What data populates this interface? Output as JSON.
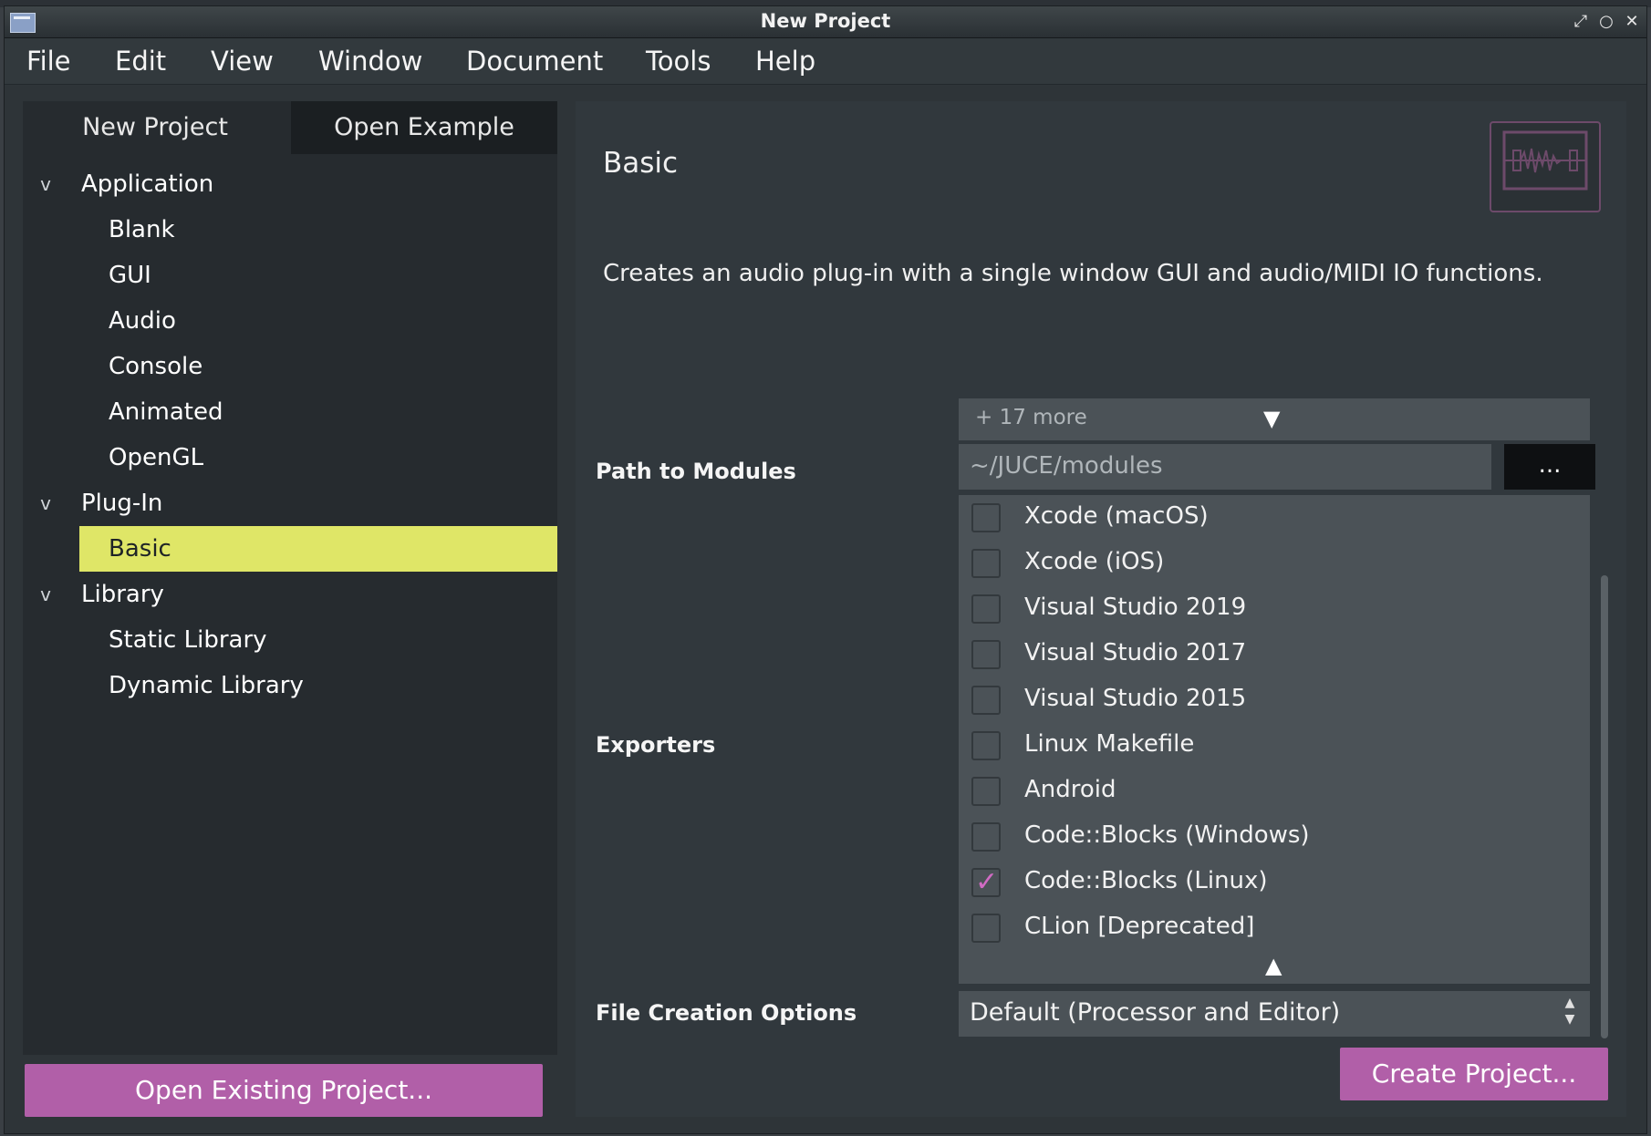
{
  "window": {
    "title": "New Project"
  },
  "menu": [
    "File",
    "Edit",
    "View",
    "Window",
    "Document",
    "Tools",
    "Help"
  ],
  "left_panel": {
    "tabs": [
      "New Project",
      "Open Example"
    ],
    "tree": {
      "application": {
        "label": "Application",
        "items": [
          "Blank",
          "GUI",
          "Audio",
          "Console",
          "Animated",
          "OpenGL"
        ]
      },
      "plugin": {
        "label": "Plug-In",
        "items": [
          "Basic"
        ]
      },
      "library": {
        "label": "Library",
        "items": [
          "Static Library",
          "Dynamic Library"
        ]
      }
    },
    "selected_item": "Basic",
    "open_existing_label": "Open Existing Project..."
  },
  "right_panel": {
    "heading": "Basic",
    "description": "Creates an audio plug-in with a single window GUI and audio/MIDI IO functions.",
    "path_to_modules": {
      "label": "Path to Modules",
      "more_text": "+ 17 more",
      "value": "~/JUCE/modules",
      "browse_label": "..."
    },
    "exporters": {
      "label": "Exporters",
      "items": [
        {
          "label": "Xcode (macOS)",
          "checked": false
        },
        {
          "label": "Xcode (iOS)",
          "checked": false
        },
        {
          "label": "Visual Studio 2019",
          "checked": false
        },
        {
          "label": "Visual Studio 2017",
          "checked": false
        },
        {
          "label": "Visual Studio 2015",
          "checked": false
        },
        {
          "label": "Linux Makefile",
          "checked": false
        },
        {
          "label": "Android",
          "checked": false
        },
        {
          "label": "Code::Blocks (Windows)",
          "checked": false
        },
        {
          "label": "Code::Blocks (Linux)",
          "checked": true
        },
        {
          "label": "CLion [Deprecated]",
          "checked": false
        }
      ]
    },
    "file_creation_options": {
      "label": "File Creation Options",
      "value": "Default (Processor and Editor)"
    },
    "create_label": "Create Project..."
  },
  "colors": {
    "accent_button": "#b15fa8",
    "selection": "#dfe667",
    "check": "#d16bc4"
  }
}
